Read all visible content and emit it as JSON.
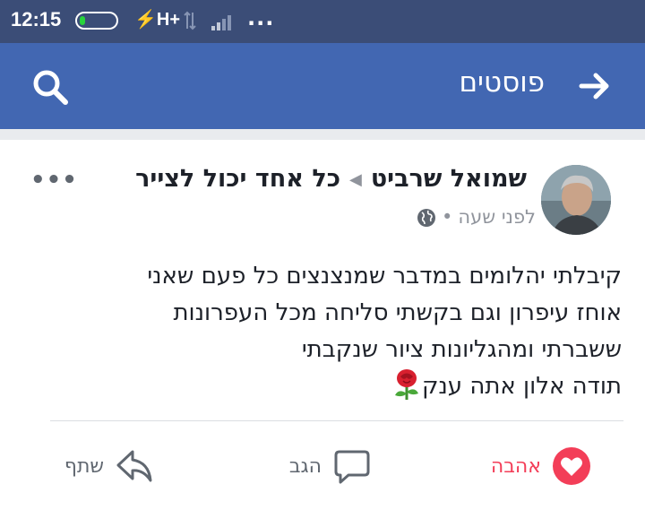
{
  "status_bar": {
    "time": "12:15",
    "network": "H+",
    "dots": "..."
  },
  "app_bar": {
    "title": "פוסטים",
    "search_icon": "search-icon",
    "back_icon": "arrow-right-icon"
  },
  "post": {
    "author": "שמואל שרביט",
    "group": "כל אחד יכול לצייר",
    "time": "לפני שעה",
    "privacy_icon": "globe-icon",
    "text_lines": [
      "קיבלתי יהלומים במדבר שמנצנצים  כל פעם שאני",
      "אוחז עיפרון וגם בקשתי סליחה מכל  העפרונות",
      "ששברתי ומהגליונות ציור שנקבתי",
      "תודה אלון אתה ענק"
    ],
    "emoji": "rose-icon"
  },
  "actions": {
    "love": "אהבה",
    "comment": "הגב",
    "share": "שתף"
  },
  "colors": {
    "status_bar": "#3b4d77",
    "app_bar": "#4267b2",
    "love": "#f33e58",
    "battery": "#27d33b"
  }
}
